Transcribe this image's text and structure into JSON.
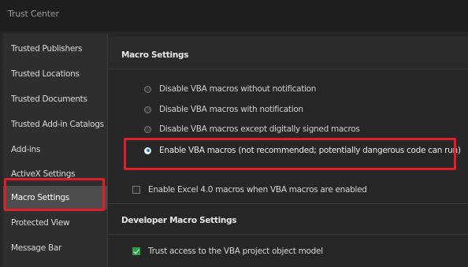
{
  "window": {
    "title": "Trust Center"
  },
  "sidebar": {
    "items": [
      {
        "label": "Trusted Publishers",
        "selected": false
      },
      {
        "label": "Trusted Locations",
        "selected": false
      },
      {
        "label": "Trusted Documents",
        "selected": false
      },
      {
        "label": "Trusted Add-in Catalogs",
        "selected": false
      },
      {
        "label": "Add-ins",
        "selected": false
      },
      {
        "label": "ActiveX Settings",
        "selected": false
      },
      {
        "label": "Macro Settings",
        "selected": true
      },
      {
        "label": "Protected View",
        "selected": false
      },
      {
        "label": "Message Bar",
        "selected": false
      }
    ]
  },
  "macro_settings": {
    "title": "Macro Settings",
    "options": [
      {
        "label": "Disable VBA macros without notification",
        "checked": false
      },
      {
        "label": "Disable VBA macros with notification",
        "checked": false
      },
      {
        "label": "Disable VBA macros except digitally signed macros",
        "checked": false
      },
      {
        "label": "Enable VBA macros (not recommended; potentially dangerous code can run)",
        "checked": true
      }
    ],
    "excel4_checkbox": {
      "label": "Enable Excel 4.0 macros when VBA macros are enabled",
      "checked": false
    }
  },
  "developer_macro_settings": {
    "title": "Developer Macro Settings",
    "trust_vba_checkbox": {
      "label": "Trust access to the VBA project object model",
      "checked": true
    }
  },
  "colors": {
    "highlight": "#e01e2a",
    "check_green": "#2f9e44",
    "radio_blue": "#1f7bd1"
  }
}
